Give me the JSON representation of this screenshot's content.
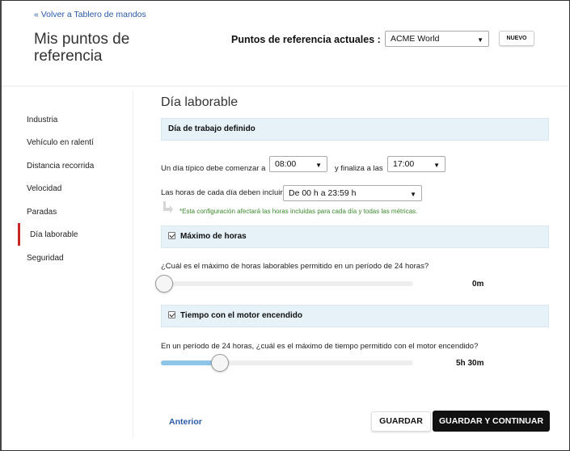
{
  "header": {
    "back_link": "« Volver a Tablero de mandos",
    "title": "Mis puntos de referencia",
    "ref_label": "Puntos de referencia actuales :",
    "ref_select_value": "ACME World",
    "new_button": "NUEVO"
  },
  "sidebar": {
    "items": [
      {
        "label": "Industria",
        "active": false
      },
      {
        "label": "Vehículo en ralentí",
        "active": false
      },
      {
        "label": "Distancia recorrida",
        "active": false
      },
      {
        "label": "Velocidad",
        "active": false
      },
      {
        "label": "Paradas",
        "active": false
      },
      {
        "label": "Día laborable",
        "active": true
      },
      {
        "label": "Seguridad",
        "active": false
      }
    ],
    "active_color": "#c62828"
  },
  "main": {
    "title": "Día laborable",
    "workday_band": "Día de trabajo definido",
    "start_label": "Un día típico debe comenzar a",
    "start_value": "08:00",
    "end_label": "y finaliza a las",
    "end_value": "17:00",
    "hours_label": "Las horas de cada día deben incluir",
    "hours_value": "De 00 h a 23:59 h",
    "note": "*Esta configuración afectará las horas incluidas para cada día y todas las métricas.",
    "max_hours": {
      "label": "Máximo de horas",
      "checked": true,
      "question": "¿Cuál es el máximo de horas laborables permitido en un período de 24 horas?",
      "value_text": "0m",
      "fraction": 0.0
    },
    "engine_time": {
      "label": "Tiempo con el motor encendido",
      "checked": true,
      "question": "En un período de 24 horas, ¿cuál es el máximo de tiempo permitido con el motor encendido?",
      "value_text": "5h 30m",
      "fraction": 0.24
    }
  },
  "footer": {
    "prev_link": "Anterior",
    "save_button": "GUARDAR",
    "save_continue_button": "GUARDAR Y CONTINUAR"
  },
  "colors": {
    "link": "#2a5aa8",
    "band_bg": "#e6f2f8",
    "note": "#3c8a2e",
    "slider_fill": "#8ec4e8"
  }
}
